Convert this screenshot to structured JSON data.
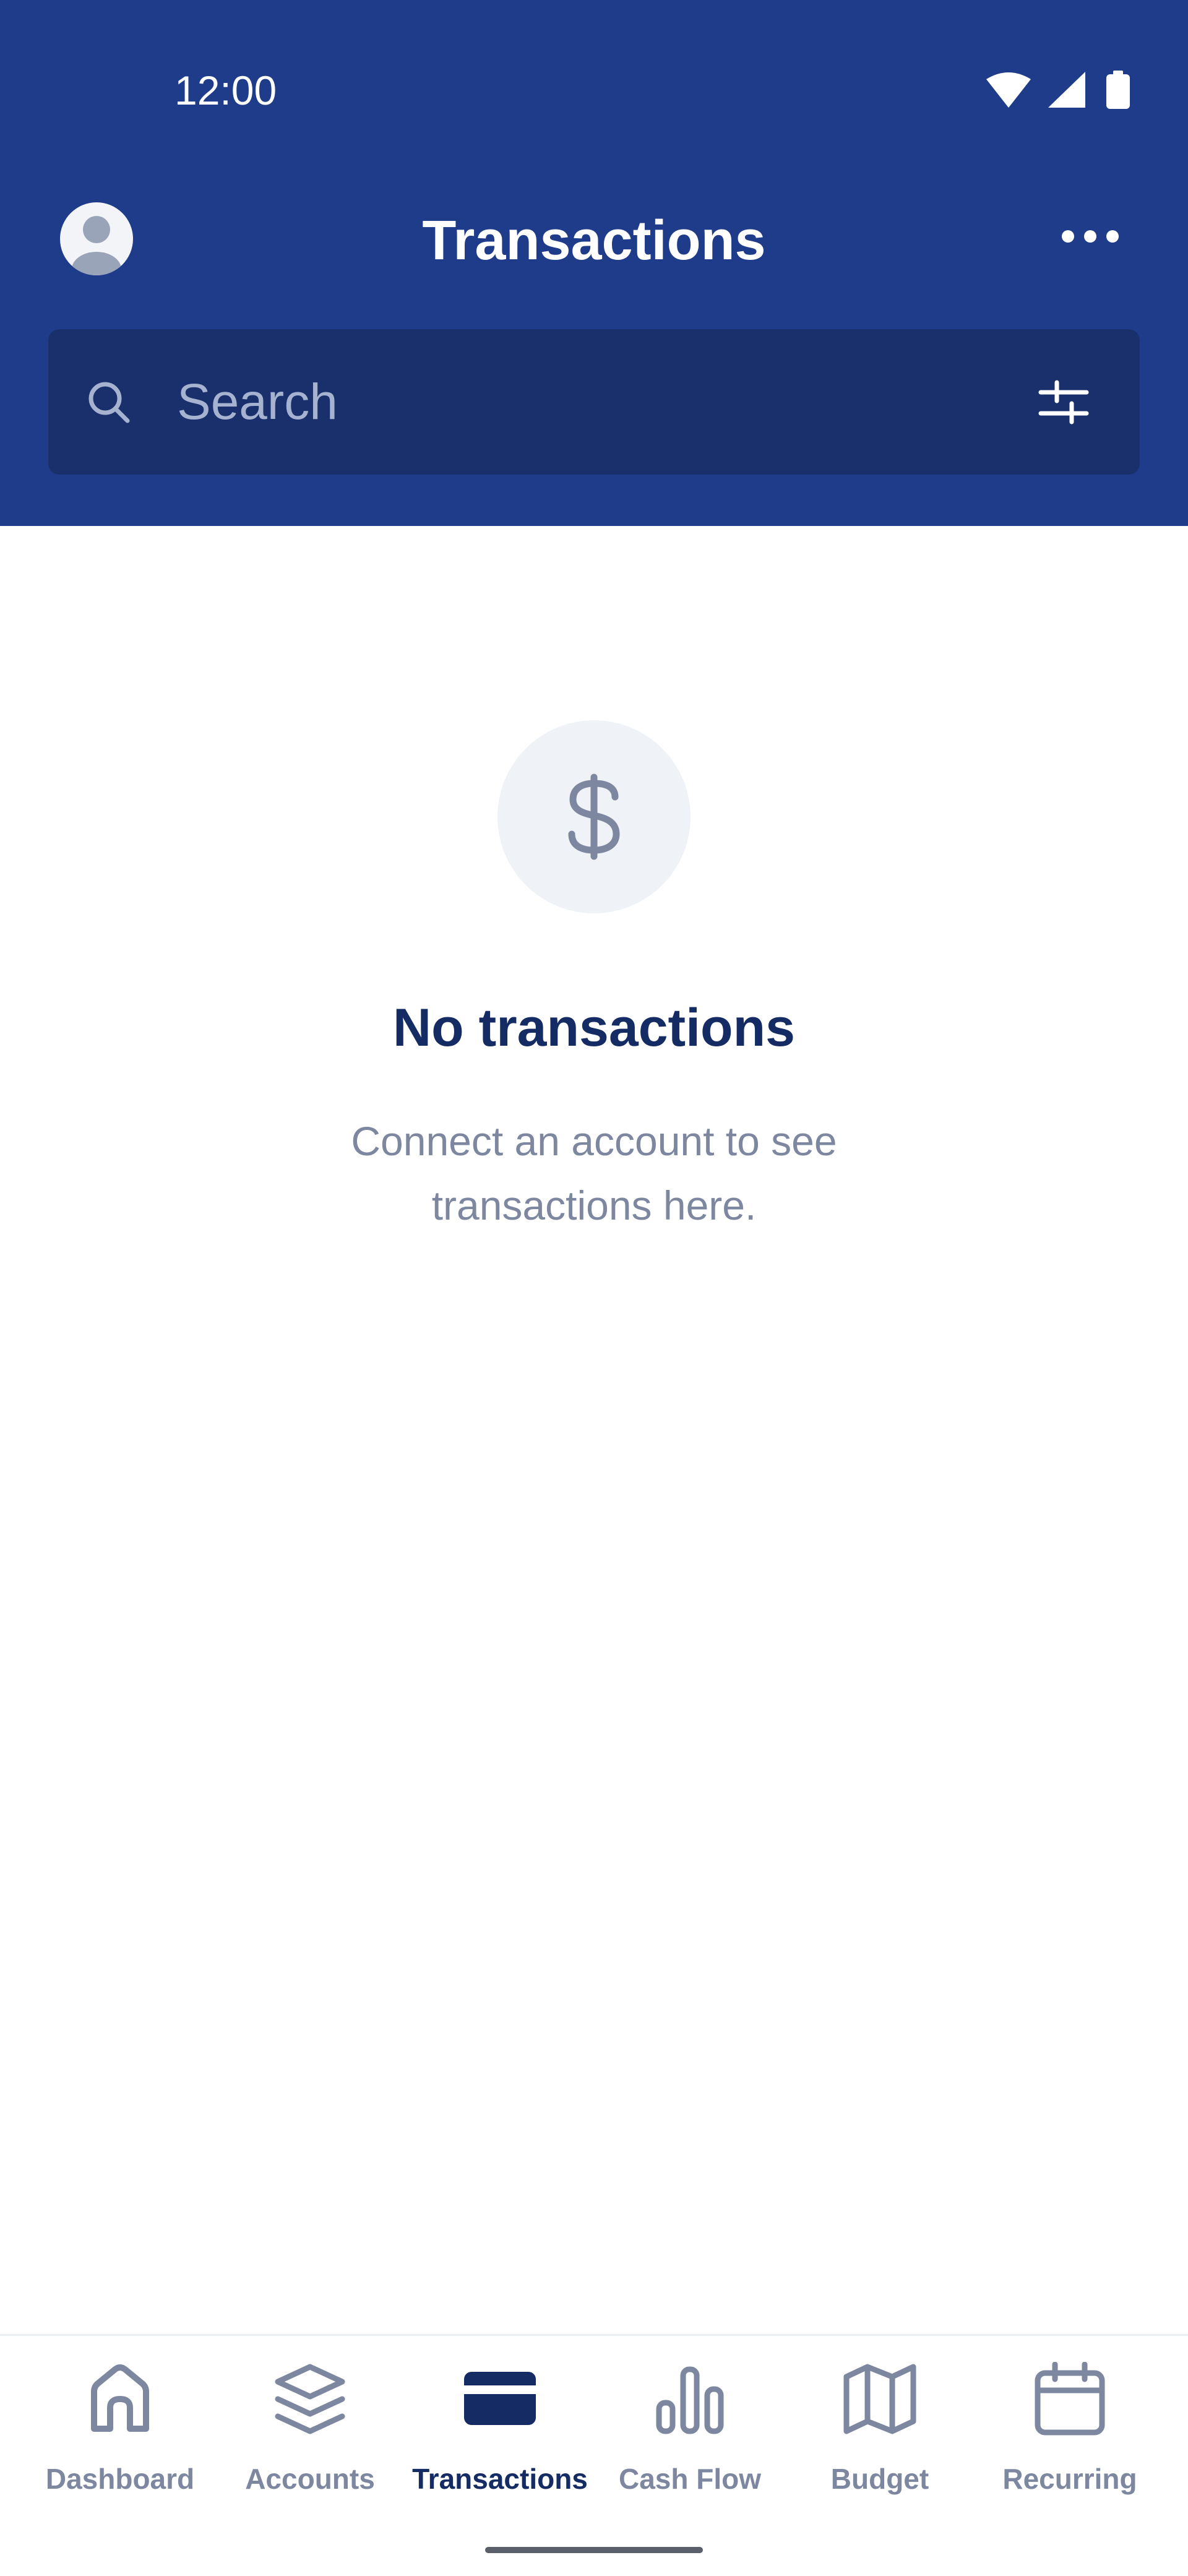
{
  "status_bar": {
    "time": "12:00"
  },
  "header": {
    "title": "Transactions"
  },
  "search": {
    "placeholder": "Search"
  },
  "empty_state": {
    "title": "No transactions",
    "message_line1": "Connect an account to see",
    "message_line2": "transactions here."
  },
  "tabs": [
    {
      "label": "Dashboard",
      "icon": "home-icon",
      "active": false
    },
    {
      "label": "Accounts",
      "icon": "layers-icon",
      "active": false
    },
    {
      "label": "Transactions",
      "icon": "credit-card-icon",
      "active": true
    },
    {
      "label": "Cash Flow",
      "icon": "bar-chart-icon",
      "active": false
    },
    {
      "label": "Budget",
      "icon": "map-icon",
      "active": false
    },
    {
      "label": "Recurring",
      "icon": "calendar-icon",
      "active": false
    }
  ],
  "colors": {
    "header_bg": "#1e3c89",
    "search_bg": "#19306c",
    "accent": "#142b63",
    "muted": "#7d87a0"
  }
}
